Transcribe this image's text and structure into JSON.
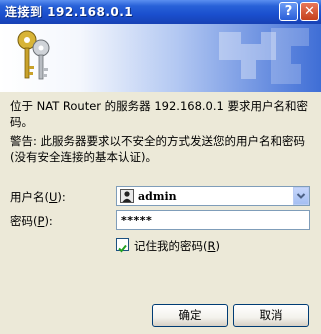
{
  "window": {
    "title": "连接到 192.168.0.1"
  },
  "titlebar_buttons": {
    "help": "?",
    "close": "✕"
  },
  "icons": {
    "banner": "keys-icon",
    "user": "user-account-icon"
  },
  "dialog": {
    "description": "位于 NAT Router 的服务器 192.168.0.1 要求用户名和密码。",
    "warning": "警告: 此服务器要求以不安全的方式发送您的用户名和密码(没有安全连接的基本认证)。"
  },
  "form": {
    "username_label": "用户名",
    "username_mnemonic": "U",
    "username_value": "admin",
    "password_label": "密码",
    "password_mnemonic": "P",
    "password_value": "*****",
    "remember_label": "记住我的密码",
    "remember_mnemonic": "R",
    "remember_checked": true
  },
  "buttons": {
    "ok": "确定",
    "cancel": "取消"
  },
  "colors": {
    "titlebar": "#1a4fce",
    "background": "#ece9d8",
    "button_border": "#003c74"
  }
}
